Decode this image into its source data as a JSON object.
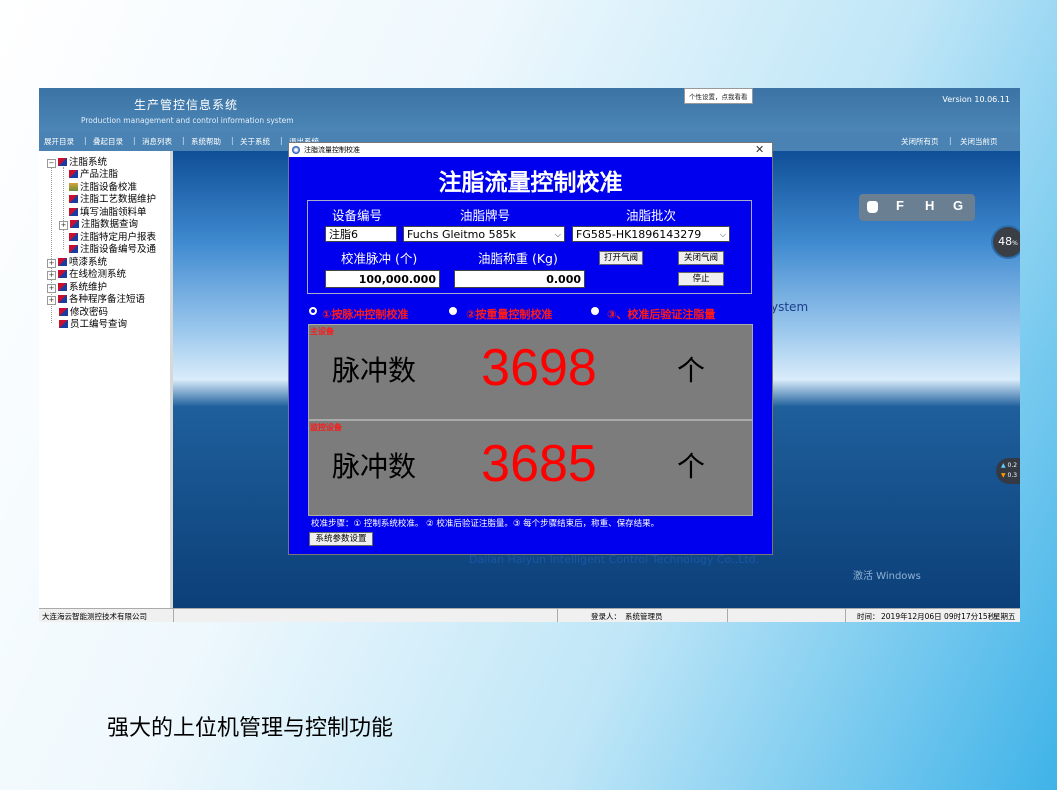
{
  "app": {
    "title": "生产管控信息系统",
    "subtitle": "Production management and control information system",
    "version": "Version 10.06.11",
    "tooltip": "个性设置，点我看看"
  },
  "menu": {
    "items": [
      "展开目录",
      "叠起目录",
      "消息列表",
      "系统帮助",
      "关于系统",
      "退出系统"
    ],
    "right_items": [
      "关闭所有页",
      "关闭当前页"
    ],
    "separator": "|"
  },
  "tree": {
    "root": "注脂系统",
    "children": [
      "产品注脂",
      "注脂设备校准",
      "注脂工艺数据维护",
      "填写油脂领料单",
      "注脂数据查询",
      "注脂特定用户报表",
      "注脂设备编号及通"
    ],
    "others": [
      "喷漆系统",
      "在线检测系统",
      "系统维护",
      "各种程序备注短语",
      "修改密码",
      "员工编号查询"
    ]
  },
  "desktop": {
    "system_text": "ystem",
    "company": "Dalian Haiyun Intelligent Control Technology Co.,Ltd.",
    "windows_text": "激活 Windows",
    "fhg": [
      "F",
      "H",
      "G"
    ],
    "percent": "48",
    "percent_unit": "%",
    "net_up": "0.2",
    "net_down": "0.3"
  },
  "dialog": {
    "window_title": "注脂流量控制校准",
    "heading": "注脂流量控制校准",
    "labels": {
      "device_no": "设备编号",
      "grease_brand": "油脂牌号",
      "grease_batch": "油脂批次",
      "pulse": "校准脉冲 (个)",
      "weight": "油脂称重 (Kg)"
    },
    "values": {
      "device_no": "注脂6",
      "grease_brand": "Fuchs Gleitmo 585k",
      "grease_batch": "FG585-HK1896143279",
      "pulse": "100,000.000",
      "weight": "0.000"
    },
    "buttons": {
      "open_valve": "打开气阀",
      "close_valve": "关闭气阀",
      "stop": "停止",
      "params": "系统参数设置"
    },
    "modes": [
      "①按脉冲控制校准",
      "②按重量控制校准",
      "③、校准后验证注脂量"
    ],
    "main": {
      "label": "主设备",
      "key": "脉冲数",
      "value": "3698",
      "unit": "个"
    },
    "monitor": {
      "label": "监控设备",
      "key": "脉冲数",
      "value": "3685",
      "unit": "个"
    },
    "steps": "校准步骤：① 控制系统校准。 ② 校准后验证注脂量。③ 每个步骤结束后，称重、保存结果。"
  },
  "status": {
    "company": "大连海云智能测控技术有限公司",
    "login_label": "登录人：",
    "login_user": "系统管理员",
    "time_label": "时间：",
    "time_value": "2019年12月06日  09时17分15秒",
    "weekday": "星期五"
  },
  "caption": "强大的上位机管理与控制功能"
}
